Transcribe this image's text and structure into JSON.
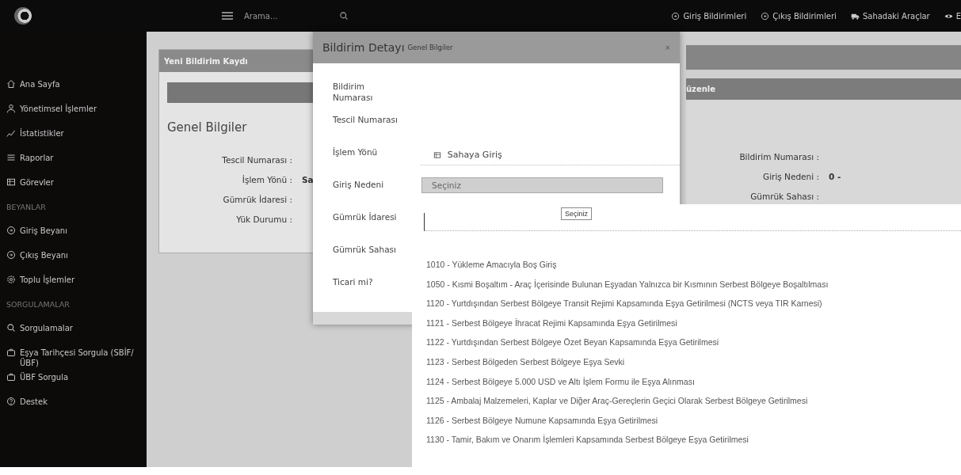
{
  "header": {
    "search": {
      "placeholder": "Arama..."
    },
    "nav": [
      {
        "label": "Giriş Bildirimleri"
      },
      {
        "label": "Çıkış Bildirimleri"
      },
      {
        "label": "Sahadaki Araçlar"
      },
      {
        "label": "E"
      }
    ]
  },
  "sidebar": {
    "items": [
      {
        "kind": "item",
        "label": "Ana Sayfa"
      },
      {
        "kind": "item",
        "label": "Yönetimsel İşlemler"
      },
      {
        "kind": "item",
        "label": "İstatistikler"
      },
      {
        "kind": "item",
        "label": "Raporlar"
      },
      {
        "kind": "item",
        "label": "Görevler"
      },
      {
        "kind": "heading",
        "label": "BEYANLAR"
      },
      {
        "kind": "item",
        "label": "Giriş Beyanı"
      },
      {
        "kind": "item",
        "label": "Çıkış Beyanı"
      },
      {
        "kind": "item",
        "label": "Toplu İşlemler"
      },
      {
        "kind": "heading",
        "label": "SORGULAMALAR"
      },
      {
        "kind": "item",
        "label": "Sorgulamalar"
      },
      {
        "kind": "item",
        "label": "Eşya Tarihçesi Sorgula (SBİF/ÜBF)"
      },
      {
        "kind": "item",
        "label": "ÜBF Sorgula"
      },
      {
        "kind": "item",
        "label": "Destek"
      }
    ]
  },
  "record_panel": {
    "title": "Yeni Bildirim Kaydı",
    "section": "Genel Bilgiler",
    "fields": [
      {
        "label": "Tescil Numarası :"
      },
      {
        "label": "İşlem Yönü :",
        "value": "Sa"
      },
      {
        "label": "Gümrük İdaresi :"
      },
      {
        "label": "Yük Durumu :"
      }
    ]
  },
  "edit_panel": {
    "title": "üzenle",
    "fields": [
      {
        "label": "Bildirim Numarası :"
      },
      {
        "label": "Giriş Nedeni :",
        "value": "0 -"
      },
      {
        "label": "Gümrük Sahası :"
      }
    ]
  },
  "modal": {
    "title": "Bildirim Detayı",
    "subtitle": "Genel Bilgiler",
    "close": "×",
    "fields": [
      {
        "label": "Bildirim Numarası",
        "kind": "static"
      },
      {
        "label": "Tescil Numarası",
        "kind": "static"
      },
      {
        "label": "İşlem Yönü",
        "kind": "value",
        "value": "Sahaya Giriş"
      },
      {
        "label": "Giriş Nedeni",
        "kind": "select",
        "placeholder": "Seçiniz",
        "disabled": true
      },
      {
        "label": "Gümrük İdaresi",
        "kind": "static"
      },
      {
        "label": "Gümrük Sahası",
        "kind": "static"
      },
      {
        "label": "Ticari mi?",
        "kind": "static"
      }
    ]
  },
  "dropdown": {
    "tooltip": "Seçiniz",
    "options": [
      {
        "label": "1010 - Yükleme Amacıyla Boş Giriş",
        "selected": false
      },
      {
        "label": "1050 - Kısmi Boşaltım - Araç İçerisinde Bulunan Eşyadan Yalnızca bir Kısmının Serbest Bölgeye Boşaltılması",
        "selected": false
      },
      {
        "label": "1120 - Yurtdışından Serbest Bölgeye Transit Rejimi Kapsamında Eşya Getirilmesi (NCTS veya TIR Karnesi)",
        "selected": false
      },
      {
        "label": "1121 - Serbest Bölgeye İhracat Rejimi Kapsamında Eşya Getirilmesi",
        "selected": false
      },
      {
        "label": "1122 - Yurtdışından Serbest Bölgeye Özet Beyan Kapsamında Eşya Getirilmesi",
        "selected": false
      },
      {
        "label": "1123 - Serbest Bölgeden Serbest Bölgeye Eşya Sevki",
        "selected": false
      },
      {
        "label": "1124 - Serbest Bölgeye 5.000 USD ve Altı İşlem Formu ile Eşya Alınması",
        "selected": false
      },
      {
        "label": "1125 - Ambalaj Malzemeleri, Kaplar ve Diğer Araç-Gereçlerin Geçici Olarak Serbest Bölgeye Getirilmesi",
        "selected": false
      },
      {
        "label": "1126 - Serbest Bölgeye Numune Kapsamında Eşya Getirilmesi",
        "selected": false
      },
      {
        "label": "1130 - Tamir, Bakım ve Onarım İşlemleri Kapsamında Serbest Bölgeye Eşya Getirilmesi",
        "selected": false
      }
    ]
  }
}
